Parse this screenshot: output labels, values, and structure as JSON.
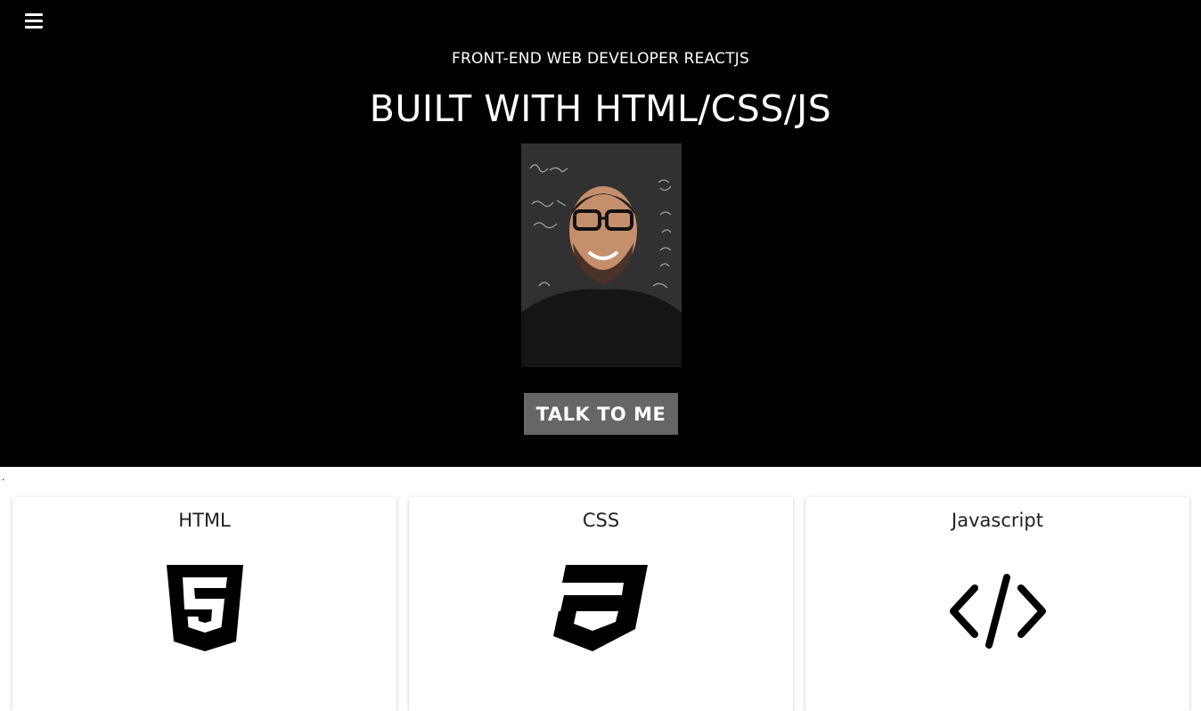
{
  "hero": {
    "subtitle": "FRONT-END WEB DEVELOPER REACTJS",
    "title": "BUILT WITH HTML/CSS/JS",
    "cta_label": "TALK TO ME",
    "menu_icon": "hamburger-menu-icon",
    "portrait_alt": "profile photo"
  },
  "stray_text": ".",
  "cards": [
    {
      "title": "HTML",
      "icon": "html5-icon"
    },
    {
      "title": "CSS",
      "icon": "css3-icon"
    },
    {
      "title": "Javascript",
      "icon": "code-icon"
    }
  ],
  "colors": {
    "hero_bg": "#000000",
    "hero_text": "#ffffff",
    "button_bg": "#666666",
    "card_bg": "#ffffff",
    "icon": "#000000"
  }
}
